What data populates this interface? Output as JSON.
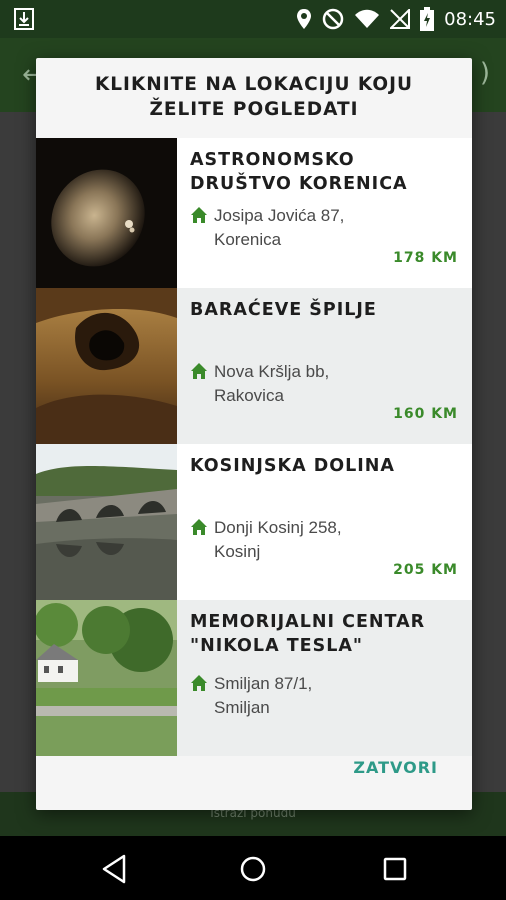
{
  "status_bar": {
    "time": "08:45",
    "icons": [
      "download-icon",
      "location-icon",
      "dnd-icon",
      "wifi-icon",
      "no-sim-icon",
      "battery-charging-icon"
    ]
  },
  "background": {
    "hint": "Istraži ponudu"
  },
  "dialog": {
    "title_line1": "KLIKNITE NA LOKACIJU KOJU",
    "title_line2": "ŽELITE POGLEDATI",
    "close_label": "ZATVORI",
    "items": [
      {
        "name_line1": "ASTRONOMSKO",
        "name_line2": "DRUŠTVO KORENICA",
        "address_line1": "Josipa Jovića 87,",
        "address_line2": "Korenica",
        "distance": "178 KM"
      },
      {
        "name_line1": "BARAĆEVE ŠPILJE",
        "name_line2": "",
        "address_line1": "Nova Kršlja bb,",
        "address_line2": "Rakovica",
        "distance": "160 KM"
      },
      {
        "name_line1": "KOSINJSKA DOLINA",
        "name_line2": "",
        "address_line1": "Donji Kosinj 258,",
        "address_line2": "Kosinj",
        "distance": "205 KM"
      },
      {
        "name_line1": "MEMORIJALNI CENTAR",
        "name_line2": "\"NIKOLA TESLA\"",
        "address_line1": "Smiljan 87/1,",
        "address_line2": "Smiljan",
        "distance": ""
      }
    ]
  },
  "colors": {
    "appbar": "#24441f",
    "accent_distance": "#3a8a2a",
    "button": "#2e9a88"
  }
}
